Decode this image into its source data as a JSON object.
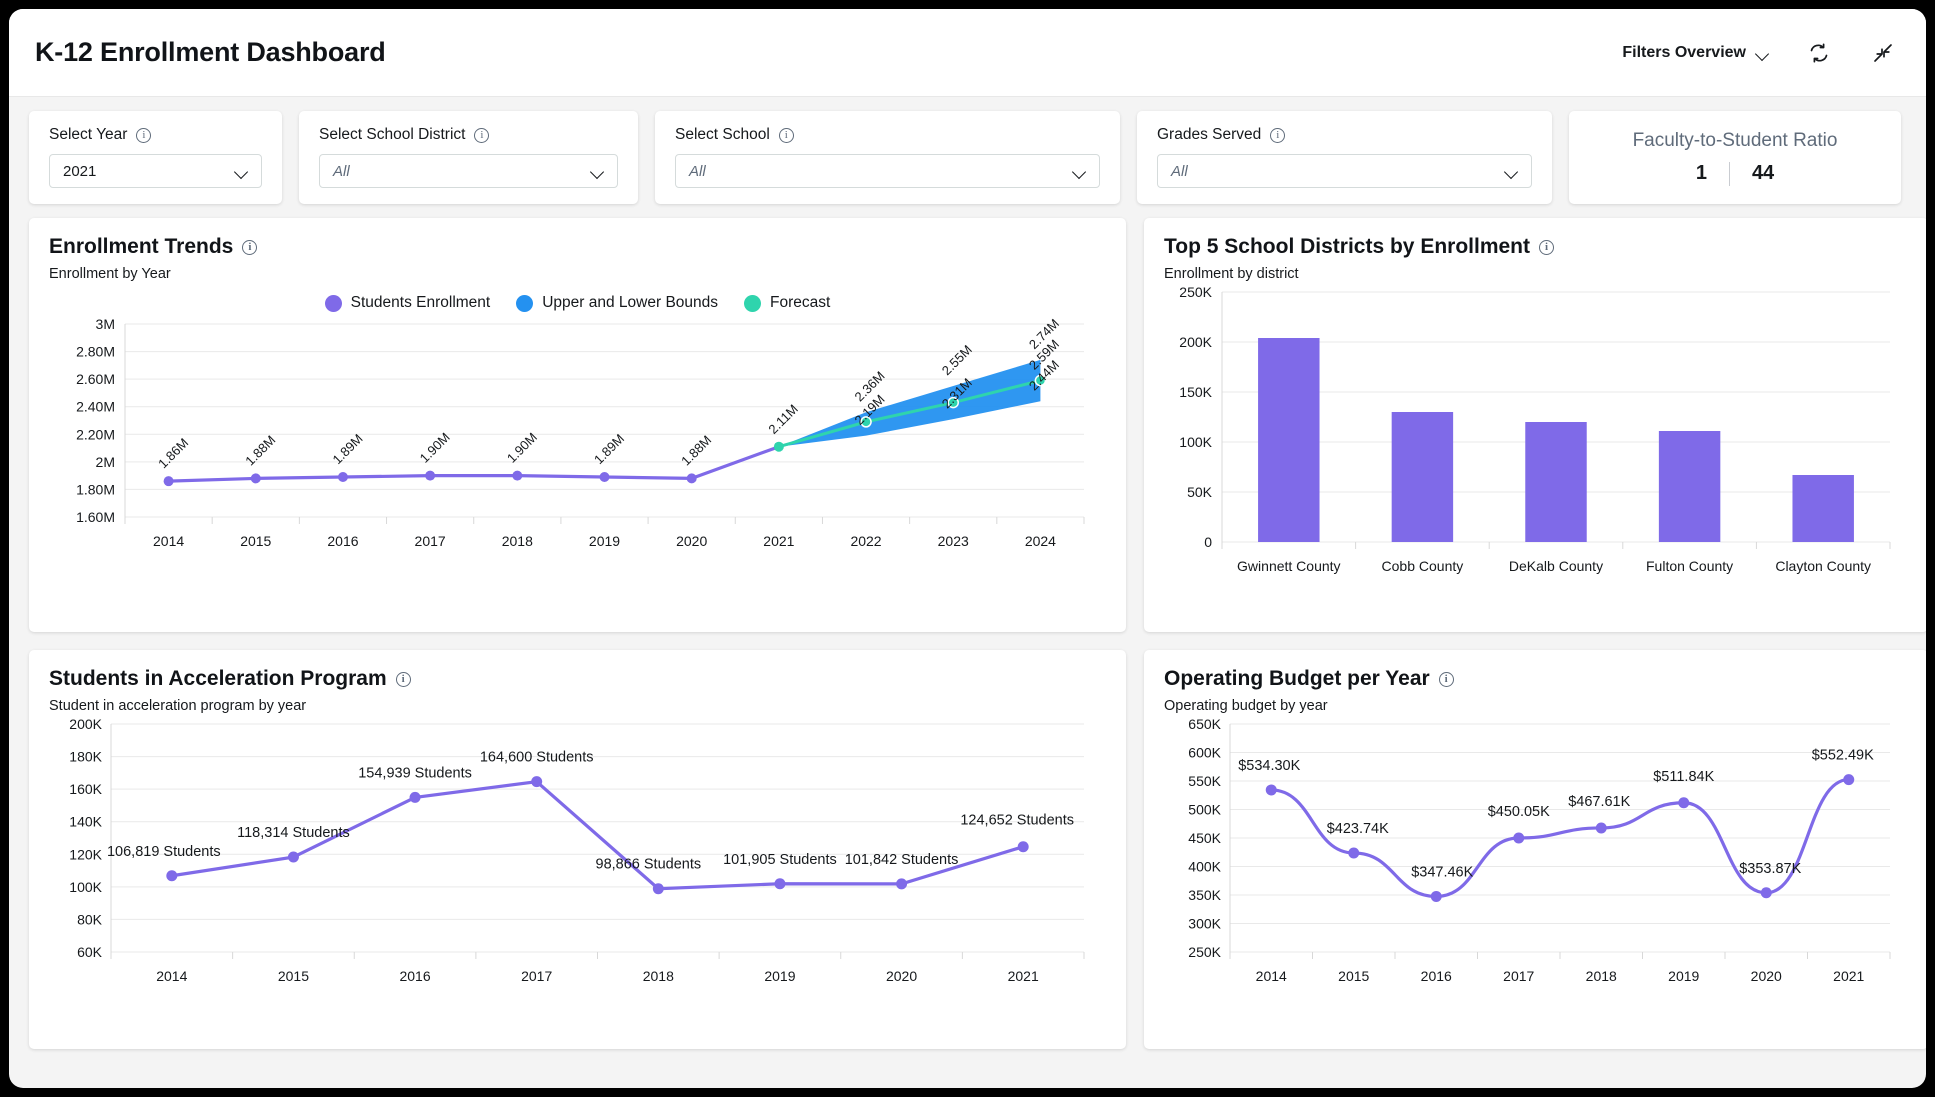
{
  "header": {
    "title": "K-12 Enrollment Dashboard",
    "filters_overview_label": "Filters Overview",
    "refresh_icon": "refresh-icon",
    "collapse_icon": "collapse-icon"
  },
  "filters": [
    {
      "label": "Select Year",
      "value": "2021",
      "is_placeholder": false
    },
    {
      "label": "Select School District",
      "value": "All",
      "is_placeholder": true
    },
    {
      "label": "Select School",
      "value": "All",
      "is_placeholder": true
    },
    {
      "label": "Grades Served",
      "value": "All",
      "is_placeholder": true
    }
  ],
  "kpi": {
    "title": "Faculty-to-Student Ratio",
    "left": "1",
    "right": "44"
  },
  "colors": {
    "purple": "#7f6ae8",
    "blue": "#2491f0",
    "teal": "#2fd4ad",
    "grid": "#e9e9e9",
    "text": "#16191c",
    "muted": "#5f6b7a"
  },
  "panels": {
    "enrollment_trends": {
      "title": "Enrollment Trends",
      "subtitle": "Enrollment by Year",
      "info_icon": "info-icon"
    },
    "top_districts": {
      "title": "Top 5 School Districts by Enrollment",
      "subtitle": "Enrollment by district",
      "info_icon": "info-icon"
    },
    "acceleration": {
      "title": "Students in Acceleration Program",
      "subtitle": "Student in acceleration program by year",
      "info_icon": "info-icon"
    },
    "budget": {
      "title": "Operating Budget per Year",
      "subtitle": "Operating budget by year",
      "info_icon": "info-icon"
    }
  },
  "chart_data": [
    {
      "id": "enrollment_trends",
      "type": "line",
      "title": "Enrollment Trends",
      "subtitle": "Enrollment by Year",
      "xlabel": "",
      "ylabel": "",
      "x": [
        "2014",
        "2015",
        "2016",
        "2017",
        "2018",
        "2019",
        "2020",
        "2021",
        "2022",
        "2023",
        "2024"
      ],
      "ylim": [
        1600000,
        3000000
      ],
      "ytick_labels": [
        "3M",
        "2.80M",
        "2.60M",
        "2.40M",
        "2.20M",
        "2M",
        "1.80M",
        "1.60M"
      ],
      "ytick_values": [
        3000000,
        2800000,
        2600000,
        2400000,
        2200000,
        2000000,
        1800000,
        1600000
      ],
      "grid": true,
      "legend_position": "top-center",
      "legend": [
        {
          "name": "Students Enrollment",
          "color": "#7f6ae8"
        },
        {
          "name": "Upper and Lower Bounds",
          "color": "#2491f0"
        },
        {
          "name": "Forecast",
          "color": "#2fd4ad"
        }
      ],
      "series": [
        {
          "name": "Students Enrollment",
          "color": "#7f6ae8",
          "x": [
            "2014",
            "2015",
            "2016",
            "2017",
            "2018",
            "2019",
            "2020",
            "2021"
          ],
          "values": [
            1860000,
            1880000,
            1890000,
            1900000,
            1900000,
            1890000,
            1880000,
            2110000
          ],
          "labels": [
            "1.86M",
            "1.88M",
            "1.89M",
            "1.90M",
            "1.90M",
            "1.89M",
            "1.88M",
            "2.11M"
          ]
        },
        {
          "name": "Forecast",
          "color": "#2fd4ad",
          "x": [
            "2021",
            "2022",
            "2023",
            "2024"
          ],
          "values": [
            2110000,
            2290000,
            2430000,
            2590000
          ],
          "labels": [
            "",
            "",
            "",
            "2.59M"
          ]
        },
        {
          "name": "Upper Bound",
          "color": "#2491f0",
          "x": [
            "2021",
            "2022",
            "2023",
            "2024"
          ],
          "values": [
            2110000,
            2360000,
            2550000,
            2740000
          ],
          "labels": [
            "",
            "2.36M",
            "2.55M",
            "2.74M"
          ]
        },
        {
          "name": "Lower Bound",
          "color": "#2491f0",
          "x": [
            "2021",
            "2022",
            "2023",
            "2024"
          ],
          "values": [
            2110000,
            2190000,
            2310000,
            2440000
          ],
          "labels": [
            "",
            "2.19M",
            "2.31M",
            "2.44M"
          ]
        }
      ]
    },
    {
      "id": "top_districts",
      "type": "bar",
      "title": "Top 5 School Districts by Enrollment",
      "subtitle": "Enrollment by district",
      "xlabel": "",
      "ylabel": "",
      "categories": [
        "Gwinnett County",
        "Cobb County",
        "DeKalb County",
        "Fulton County",
        "Clayton County"
      ],
      "values": [
        204000,
        130000,
        120000,
        111000,
        67000
      ],
      "color": "#7f6ae8",
      "ylim": [
        0,
        250000
      ],
      "ytick_labels": [
        "250K",
        "200K",
        "150K",
        "100K",
        "50K",
        "0"
      ],
      "ytick_values": [
        250000,
        200000,
        150000,
        100000,
        50000,
        0
      ],
      "grid": true
    },
    {
      "id": "acceleration",
      "type": "line",
      "title": "Students in Acceleration Program",
      "subtitle": "Student in acceleration program by year",
      "xlabel": "",
      "ylabel": "",
      "categories": [
        "2014",
        "2015",
        "2016",
        "2017",
        "2018",
        "2019",
        "2020",
        "2021"
      ],
      "values": [
        106819,
        118314,
        154939,
        164600,
        98866,
        101905,
        101842,
        124652
      ],
      "labels": [
        "106,819 Students",
        "118,314 Students",
        "154,939 Students",
        "164,600 Students",
        "98,866 Students",
        "101,905 Students",
        "101,842 Students",
        "124,652 Students"
      ],
      "color": "#7f6ae8",
      "ylim": [
        60000,
        200000
      ],
      "ytick_labels": [
        "200K",
        "180K",
        "160K",
        "140K",
        "120K",
        "100K",
        "80K",
        "60K"
      ],
      "ytick_values": [
        200000,
        180000,
        160000,
        140000,
        120000,
        100000,
        80000,
        60000
      ],
      "grid": true
    },
    {
      "id": "budget",
      "type": "line",
      "title": "Operating Budget per Year",
      "subtitle": "Operating budget by year",
      "xlabel": "",
      "ylabel": "",
      "categories": [
        "2014",
        "2015",
        "2016",
        "2017",
        "2018",
        "2019",
        "2020",
        "2021"
      ],
      "values": [
        534300,
        423740,
        347460,
        450050,
        467610,
        511840,
        353870,
        552490
      ],
      "labels": [
        "$534.30K",
        "$423.74K",
        "$347.46K",
        "$450.05K",
        "$467.61K",
        "$511.84K",
        "$353.87K",
        "$552.49K"
      ],
      "color": "#7f6ae8",
      "ylim": [
        250000,
        650000
      ],
      "ytick_labels": [
        "650K",
        "600K",
        "550K",
        "500K",
        "450K",
        "400K",
        "350K",
        "300K",
        "250K"
      ],
      "ytick_values": [
        650000,
        600000,
        550000,
        500000,
        450000,
        400000,
        350000,
        300000,
        250000
      ],
      "grid": true
    }
  ]
}
